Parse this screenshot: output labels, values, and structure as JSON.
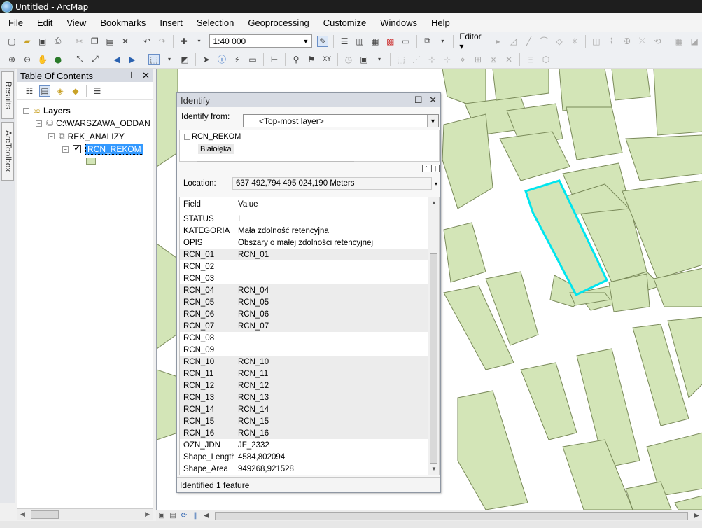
{
  "window": {
    "title": "Untitled - ArcMap"
  },
  "menu": [
    "File",
    "Edit",
    "View",
    "Bookmarks",
    "Insert",
    "Selection",
    "Geoprocessing",
    "Customize",
    "Windows",
    "Help"
  ],
  "toolbar": {
    "scale": "1:40 000",
    "editor_label": "Editor ▾"
  },
  "dock": {
    "results_tab": "Results",
    "arctoolbox_tab": "ArcToolbox"
  },
  "toc": {
    "title": "Table Of Contents",
    "layers_label": "Layers",
    "database_label": "C:\\WARSZAWA_ODDAN",
    "group_label": "REK_ANALIZY",
    "layer_label": "RCN_REKOM"
  },
  "identify": {
    "title": "Identify",
    "from_label": "Identify from:",
    "from_value": "<Top-most layer>",
    "tree_layer": "RCN_REKOM",
    "tree_feature": "Białołęka",
    "location_label": "Location:",
    "location_value": "637 492,794  495 024,190 Meters",
    "col_field": "Field",
    "col_value": "Value",
    "rows": [
      {
        "field": "STATUS",
        "value": "I"
      },
      {
        "field": "KATEGORIA",
        "value": "Mała zdolność retencyjna"
      },
      {
        "field": "OPIS",
        "value": "Obszary o małej zdolności retencyjnej"
      },
      {
        "field": "RCN_01",
        "value": "RCN_01"
      },
      {
        "field": "RCN_02",
        "value": ""
      },
      {
        "field": "RCN_03",
        "value": ""
      },
      {
        "field": "RCN_04",
        "value": "RCN_04"
      },
      {
        "field": "RCN_05",
        "value": "RCN_05"
      },
      {
        "field": "RCN_06",
        "value": "RCN_06"
      },
      {
        "field": "RCN_07",
        "value": "RCN_07"
      },
      {
        "field": "RCN_08",
        "value": ""
      },
      {
        "field": "RCN_09",
        "value": ""
      },
      {
        "field": "RCN_10",
        "value": "RCN_10"
      },
      {
        "field": "RCN_11",
        "value": "RCN_11"
      },
      {
        "field": "RCN_12",
        "value": "RCN_12"
      },
      {
        "field": "RCN_13",
        "value": "RCN_13"
      },
      {
        "field": "RCN_14",
        "value": "RCN_14"
      },
      {
        "field": "RCN_15",
        "value": "RCN_15"
      },
      {
        "field": "RCN_16",
        "value": "RCN_16"
      },
      {
        "field": "OZN_JDN",
        "value": "JF_2332"
      },
      {
        "field": "Shape_Length",
        "value": "4584,802094"
      },
      {
        "field": "Shape_Area",
        "value": "949268,921528"
      }
    ],
    "footer": "Identified 1 feature"
  },
  "colors": {
    "polygon_fill": "#d3e5b7",
    "polygon_stroke": "#7a8a5a",
    "highlight": "#00e5ee"
  }
}
